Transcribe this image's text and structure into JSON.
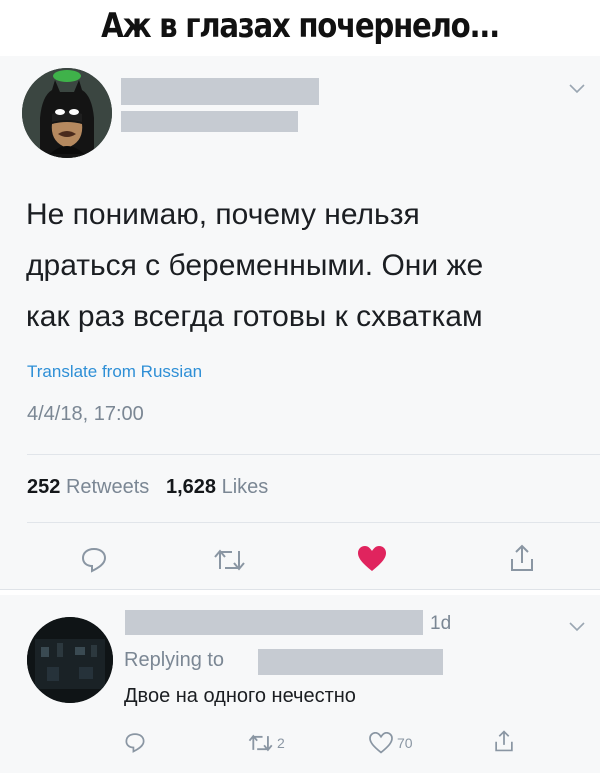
{
  "meme": {
    "title": "Аж в глазах почернело..."
  },
  "tweet": {
    "text_lines": [
      "Не понимаю, почему нельзя",
      "драться с беременными. Они же",
      "как раз всегда готовы к схваткам"
    ],
    "translate_label": "Translate from Russian",
    "timestamp": "4/4/18, 17:00",
    "retweets_count": "252",
    "retweets_label": "Retweets",
    "likes_count": "1,628",
    "likes_label": "Likes",
    "liked": true,
    "like_color": "#e0245e"
  },
  "reply": {
    "age": "1d",
    "replying_to_label": "Replying to",
    "text": "Двое на одного нечестно",
    "retweet_count": "2",
    "like_count": "70"
  },
  "colors": {
    "link": "#2e8fd6",
    "muted": "#7b8794",
    "redaction": "#c6cbd2"
  }
}
